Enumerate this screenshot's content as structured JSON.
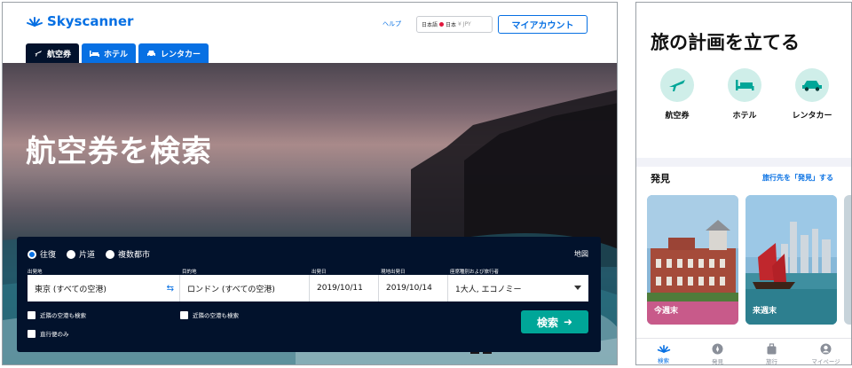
{
  "desktop": {
    "brand": "Skyscanner",
    "header": {
      "help": "ヘルプ",
      "locale_lang": "日本語",
      "locale_region": "日本",
      "locale_currency": "¥ JPY",
      "account": "マイアカウント"
    },
    "tabs": [
      {
        "label": "航空券",
        "icon": "plane-icon",
        "active": true
      },
      {
        "label": "ホテル",
        "icon": "bed-icon",
        "active": false
      },
      {
        "label": "レンタカー",
        "icon": "car-icon",
        "active": false
      }
    ],
    "hero_title": "航空券を検索",
    "search": {
      "trip_types": [
        {
          "label": "往復",
          "selected": true
        },
        {
          "label": "片道",
          "selected": false
        },
        {
          "label": "複数都市",
          "selected": false
        }
      ],
      "map_link": "地図",
      "labels": {
        "origin": "出発地",
        "destination": "目的地",
        "depart": "出発日",
        "return": "現地出発日",
        "cabin": "座席種別および旅行者"
      },
      "values": {
        "origin": "東京 (すべての空港)",
        "destination": "ロンドン (すべての空港)",
        "depart": "2019/10/11",
        "return": "2019/10/14",
        "cabin": "1大人, エコノミー"
      },
      "checkbox_nearby_origin": "近隣の空港も検索",
      "checkbox_nearby_dest": "近隣の空港も検索",
      "checkbox_direct": "直行便のみ",
      "submit": "検索"
    }
  },
  "mobile": {
    "title": "旅の計画を立てる",
    "categories": [
      {
        "label": "航空券",
        "icon": "plane-icon"
      },
      {
        "label": "ホテル",
        "icon": "bed-icon"
      },
      {
        "label": "レンタカー",
        "icon": "car-icon"
      }
    ],
    "discover": "発見",
    "discover_link": "旅行先を「発見」する",
    "cards": [
      {
        "label": "今週末"
      },
      {
        "label": "来週末"
      }
    ],
    "nav": [
      {
        "label": "検索",
        "icon": "search-nav-icon",
        "active": true
      },
      {
        "label": "発見",
        "icon": "compass-icon",
        "active": false
      },
      {
        "label": "旅行",
        "icon": "suitcase-icon",
        "active": false
      },
      {
        "label": "マイページ",
        "icon": "profile-icon",
        "active": false
      }
    ]
  },
  "colors": {
    "brand_blue": "#0770e3",
    "navy": "#02122c",
    "teal_button": "#00a698",
    "mint_circle": "#cfeee9"
  }
}
